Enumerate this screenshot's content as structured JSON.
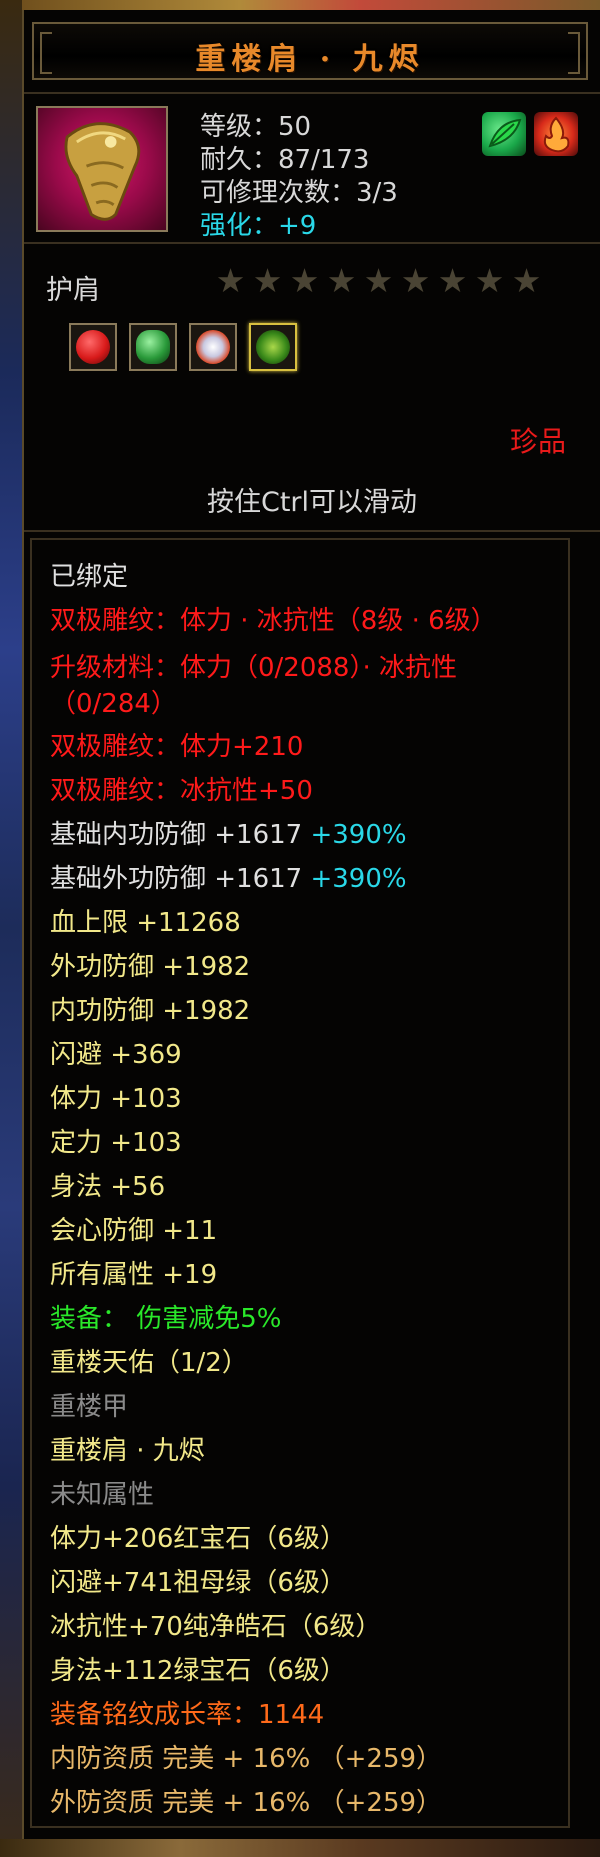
{
  "item": {
    "title": "重楼肩 · 九烬",
    "level": "等级：50",
    "durability": "耐久：87/173",
    "repair": "可修理次数：3/3",
    "enhance": "强化：+9",
    "type": "护肩",
    "stars_total": 9,
    "rarity": "珍品",
    "hint": "按住Ctrl可以滑动"
  },
  "header_icons": [
    {
      "name": "green-leaf-icon",
      "color": "#1aa84a"
    },
    {
      "name": "red-flame-icon",
      "color": "#d82a1a"
    }
  ],
  "slots": [
    {
      "name": "red-gem-icon",
      "color": "#d81a1a",
      "selected": false
    },
    {
      "name": "green-jade-icon",
      "color": "#2a9a3a",
      "selected": false
    },
    {
      "name": "white-crystal-icon",
      "color": "#e8e8f0",
      "selected": false
    },
    {
      "name": "emerald-gem-icon",
      "color": "#3a8a1a",
      "selected": true
    }
  ],
  "details": {
    "bound": "已绑定",
    "engrave1": "双极雕纹：体力 · 冰抗性（8级 · 6级）",
    "upgrade_material": "升级材料：体力（0/2088）· 冰抗性（0/284）",
    "engrave_stamina": "双极雕纹：体力+210",
    "engrave_ice": "双极雕纹：冰抗性+50",
    "base_inner_def": "基础内功防御 +1617",
    "base_inner_def_pct": "+390%",
    "base_outer_def": "基础外功防御 +1617",
    "base_outer_def_pct": "+390%",
    "hp_cap": "血上限 +11268",
    "outer_def": "外功防御 +1982",
    "inner_def": "内功防御 +1982",
    "dodge": "闪避 +369",
    "stamina": "体力 +103",
    "focus": "定力 +103",
    "agility": "身法 +56",
    "crit_def": "会心防御 +11",
    "all_attr": "所有属性 +19",
    "equip_effect": "装备： 伤害减免5%",
    "set_name": "重楼天佑（1/2）",
    "set_piece1": "重楼甲",
    "set_piece2": "重楼肩 · 九烬",
    "unknown_attr": "未知属性",
    "gem1": "体力+206红宝石（6级）",
    "gem2": "闪避+741祖母绿（6级）",
    "gem3": "冰抗性+70纯净皓石（6级）",
    "gem4": "身法+112绿宝石（6级）",
    "growth": "装备铭纹成长率：1144",
    "inner_quality": "内防资质 完美 + 16% （+259）",
    "outer_quality": "外防资质 完美 + 16% （+259）"
  }
}
